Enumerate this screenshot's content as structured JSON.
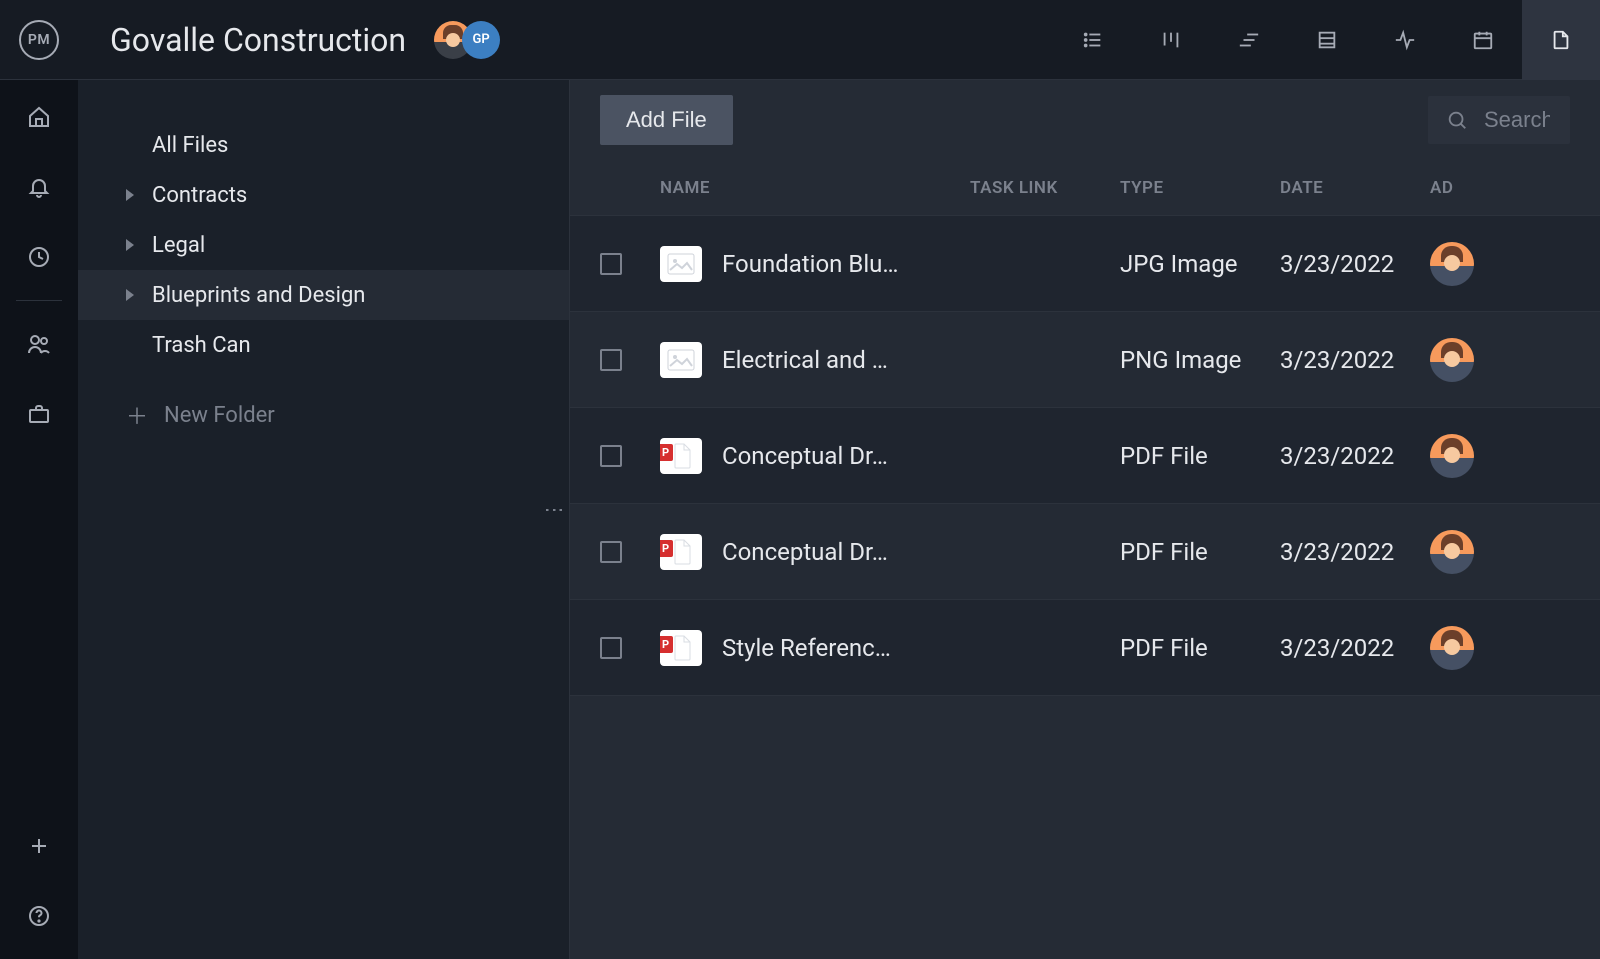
{
  "header": {
    "logo_text": "PM",
    "project_title": "Govalle Construction",
    "avatar_initials": "GP"
  },
  "view_tabs": [
    {
      "id": "list",
      "icon": "list"
    },
    {
      "id": "board",
      "icon": "board"
    },
    {
      "id": "gantt",
      "icon": "gantt"
    },
    {
      "id": "sheet",
      "icon": "sheet"
    },
    {
      "id": "workload",
      "icon": "activity"
    },
    {
      "id": "calendar",
      "icon": "calendar"
    },
    {
      "id": "files",
      "icon": "file",
      "active": true
    }
  ],
  "sidebar": {
    "root": "All Files",
    "folders": [
      {
        "label": "Contracts",
        "expanded": false
      },
      {
        "label": "Legal",
        "expanded": false
      },
      {
        "label": "Blueprints and Design",
        "expanded": false,
        "selected": true
      }
    ],
    "trash": "Trash Can",
    "new_folder_label": "New Folder"
  },
  "toolbar": {
    "add_label": "Add File",
    "search_placeholder": "Search"
  },
  "table": {
    "columns": {
      "name": "NAME",
      "task": "TASK LINK",
      "type": "TYPE",
      "date": "DATE",
      "added": "AD"
    },
    "rows": [
      {
        "name": "Foundation Blu…",
        "icon": "image",
        "type": "JPG Image",
        "date": "3/23/2022",
        "task": ""
      },
      {
        "name": "Electrical and …",
        "icon": "image",
        "type": "PNG Image",
        "date": "3/23/2022",
        "task": ""
      },
      {
        "name": "Conceptual Dr…",
        "icon": "pdf",
        "type": "PDF File",
        "date": "3/23/2022",
        "task": ""
      },
      {
        "name": "Conceptual Dr…",
        "icon": "pdf",
        "type": "PDF File",
        "date": "3/23/2022",
        "task": ""
      },
      {
        "name": "Style Referenc…",
        "icon": "pdf",
        "type": "PDF File",
        "date": "3/23/2022",
        "task": ""
      }
    ]
  }
}
